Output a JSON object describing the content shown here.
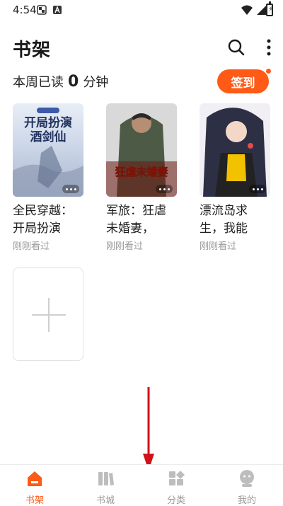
{
  "status_bar": {
    "time": "4:54"
  },
  "header": {
    "title": "书架",
    "search_icon": "search-icon",
    "more_icon": "more-vertical-icon"
  },
  "reading": {
    "prefix": "本周已读",
    "minutes": "0",
    "unit": "分钟"
  },
  "signin": {
    "label": "签到"
  },
  "books": [
    {
      "title": "全民穿越：开局扮演酒…",
      "status": "刚刚看过",
      "cover_text": "开局扮演酒剑仙"
    },
    {
      "title": "军旅：狂虐未婚妻，岳…",
      "status": "刚刚看过",
      "cover_text": "狂虐未婚妻"
    },
    {
      "title": "漂流岛求生，我能扫…",
      "status": "刚刚看过",
      "cover_text": ""
    }
  ],
  "tabs": [
    {
      "label": "书架",
      "icon": "bookshelf-icon",
      "active": true
    },
    {
      "label": "书城",
      "icon": "bookstore-icon",
      "active": false
    },
    {
      "label": "分类",
      "icon": "category-icon",
      "active": false
    },
    {
      "label": "我的",
      "icon": "profile-icon",
      "active": false
    }
  ],
  "colors": {
    "accent": "#ff5a16",
    "arrow": "#d0121b"
  }
}
